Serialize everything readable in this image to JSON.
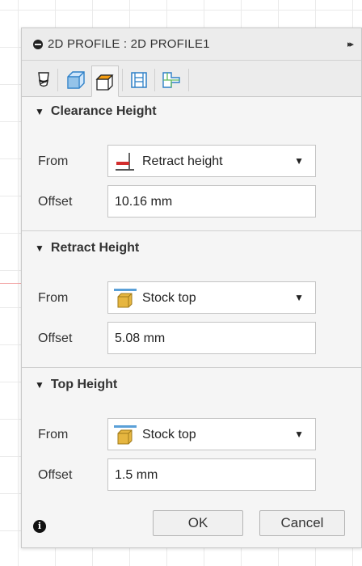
{
  "dialog": {
    "title": "2D PROFILE : 2D PROFILE1",
    "expand_glyph": "▸▸"
  },
  "tabs": [
    {
      "name": "tool-tab",
      "icon": "tool-icon"
    },
    {
      "name": "geometry-tab",
      "icon": "geometry-icon"
    },
    {
      "name": "heights-tab",
      "icon": "heights-icon",
      "selected": true
    },
    {
      "name": "passes-tab",
      "icon": "passes-icon"
    },
    {
      "name": "linking-tab",
      "icon": "linking-icon"
    }
  ],
  "sections": {
    "clearance": {
      "title": "Clearance Height",
      "from_label": "From",
      "from_value": "Retract height",
      "offset_label": "Offset",
      "offset_value": "10.16 mm"
    },
    "retract": {
      "title": "Retract Height",
      "from_label": "From",
      "from_value": "Stock top",
      "offset_label": "Offset",
      "offset_value": "5.08 mm"
    },
    "top": {
      "title": "Top Height",
      "from_label": "From",
      "from_value": "Stock top",
      "offset_label": "Offset",
      "offset_value": "1.5 mm"
    }
  },
  "footer": {
    "info": "i",
    "ok_label": "OK",
    "cancel_label": "Cancel"
  },
  "colors": {
    "accent_red": "#d32f2f",
    "accent_blue": "#5aa0d8",
    "stock_yellow": "#e6b640",
    "tab_orange": "#f39c12"
  }
}
